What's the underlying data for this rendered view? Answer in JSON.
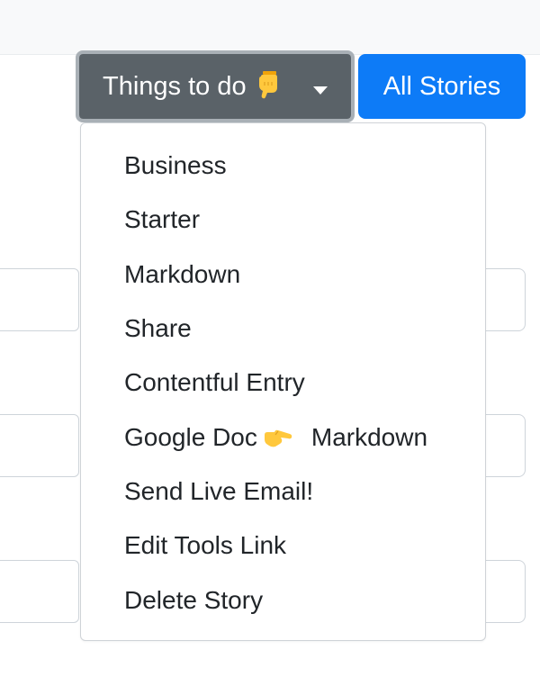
{
  "toolbar": {
    "dropdown_label": "Things to do",
    "dropdown_icon": "backhand-index-pointing-down",
    "all_stories_label": "All Stories"
  },
  "menu": {
    "items": [
      {
        "label": "Business"
      },
      {
        "label": "Starter"
      },
      {
        "label": "Markdown"
      },
      {
        "label": "Share"
      },
      {
        "label": "Contentful Entry"
      },
      {
        "label_before": "Google Doc",
        "icon": "backhand-index-pointing-right",
        "label_after": "Markdown"
      },
      {
        "label": "Send Live Email!"
      },
      {
        "label": "Edit Tools Link"
      },
      {
        "label": "Delete Story"
      }
    ]
  },
  "colors": {
    "dropdown_bg": "#5a6268",
    "dropdown_focus_ring": "#a9b0b6",
    "primary_button": "#0d7bf7",
    "menu_border": "#cfd3d7",
    "text": "#212529"
  }
}
